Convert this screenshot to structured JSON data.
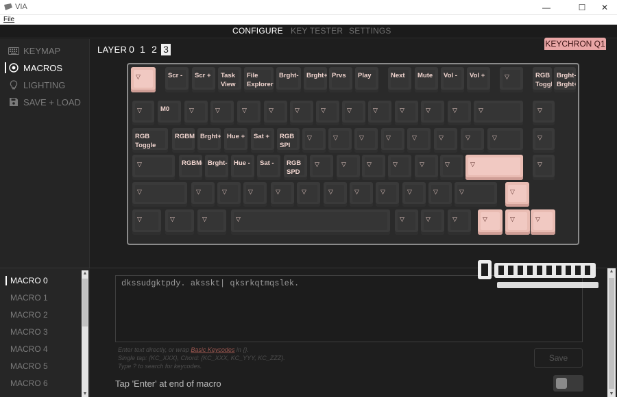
{
  "window": {
    "title": "VIA",
    "minimize": "—",
    "maximize": "☐",
    "close": "✕"
  },
  "menu": {
    "file": "File"
  },
  "nav": {
    "configure": "CONFIGURE",
    "key_tester": "KEY TESTER",
    "settings": "SETTINGS"
  },
  "sidebar": {
    "items": [
      {
        "label": "KEYMAP",
        "icon": "keyboard-icon"
      },
      {
        "label": "MACROS",
        "icon": "target-icon"
      },
      {
        "label": "LIGHTING",
        "icon": "lightbulb-icon"
      },
      {
        "label": "SAVE + LOAD",
        "icon": "floppy-icon"
      }
    ],
    "active": "MACROS"
  },
  "layers": {
    "label": "LAYER",
    "values": [
      "0",
      "1",
      "2",
      "3"
    ],
    "active": "3"
  },
  "keyboard": {
    "name": "KEYCHRON Q1",
    "transparent_key_glyph": "▽",
    "row0": [
      "",
      "Scr -",
      "Scr +",
      "Task\nView",
      "File\nExplorer",
      "Brght-",
      "Brght+",
      "Prvs",
      "Play",
      "Next",
      "Mute",
      "Vol -",
      "Vol +",
      "",
      "RGB\nToggl",
      "Brght-\nBrght+"
    ],
    "row1": [
      "",
      "M0",
      "",
      "",
      "",
      "",
      "",
      "",
      "",
      "",
      "",
      "",
      "",
      "",
      ""
    ],
    "row2": [
      "RGB\nToggle",
      "RGBMd-",
      "Brght+",
      "Hue +",
      "Sat +",
      "RGB\nSPI",
      "",
      "",
      "",
      "",
      "",
      "",
      "",
      "",
      ""
    ],
    "row3": [
      "",
      "RGBMd-",
      "Brght-",
      "Hue -",
      "Sat -",
      "RGB\nSPD",
      "",
      "",
      "",
      "",
      "",
      "",
      "",
      ""
    ],
    "row4": [
      "",
      "",
      "",
      "",
      "",
      "",
      "",
      "",
      "",
      "",
      "",
      "",
      ""
    ],
    "row5": [
      "",
      "",
      "",
      "",
      "",
      "",
      "",
      "",
      "",
      ""
    ]
  },
  "macros": {
    "items": [
      "MACRO 0",
      "MACRO 1",
      "MACRO 2",
      "MACRO 3",
      "MACRO 4",
      "MACRO 5",
      "MACRO 6"
    ],
    "active": "MACRO 0",
    "text": "dkssudgktpdy. aksskt| qksrkqtmqslek.",
    "hint1_pre": "Enter text directly, or wrap ",
    "hint1_link": "Basic Keycodes",
    "hint1_post": " in {}.",
    "hint2": "Single tap: {KC_XXX}, Chord: {KC_XXX, KC_YYY, KC_ZZZ}.",
    "hint3": "Type ? to search for keycodes.",
    "save_label": "Save",
    "enter_label": "Tap 'Enter' at end of macro",
    "enter_toggle": "off"
  },
  "colors": {
    "accent": "#e9bcb3",
    "badge": "#e9a6a6",
    "key": "#3a3a3a",
    "background": "#1e1e1e"
  }
}
